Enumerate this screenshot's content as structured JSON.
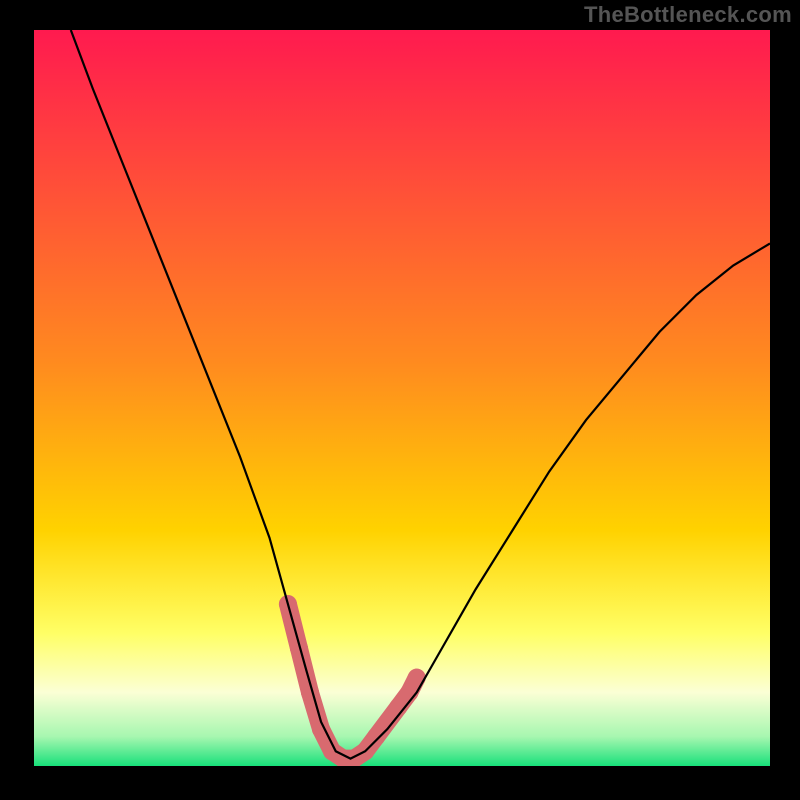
{
  "attribution": "TheBottleneck.com",
  "colors": {
    "bg_top": "#ff1a4f",
    "bg_mid": "#ffd200",
    "bg_low_yellow": "#ffff66",
    "bg_low_cream": "#fbffd5",
    "bg_bottom_green": "#18e07a",
    "page_bg": "#000000",
    "curve": "#000000",
    "marker": "#d86a6f"
  },
  "chart_data": {
    "type": "line",
    "title": "",
    "xlabel": "",
    "ylabel": "",
    "xlim": [
      0,
      100
    ],
    "ylim": [
      0,
      100
    ],
    "grid": false,
    "legend": false,
    "series": [
      {
        "name": "bottleneck_curve",
        "x": [
          5,
          8,
          12,
          16,
          20,
          24,
          28,
          32,
          34.5,
          37,
          39,
          41,
          43,
          45,
          48,
          52,
          56,
          60,
          65,
          70,
          75,
          80,
          85,
          90,
          95,
          100
        ],
        "y": [
          100,
          92,
          82,
          72,
          62,
          52,
          42,
          31,
          22,
          13,
          6,
          2,
          1,
          2,
          5,
          10,
          17,
          24,
          32,
          40,
          47,
          53,
          59,
          64,
          68,
          71
        ]
      }
    ],
    "markers": {
      "name": "highlight_points",
      "comment": "salmon rounded segments near curve minimum",
      "points": [
        {
          "x": 34.5,
          "y": 22
        },
        {
          "x": 36.0,
          "y": 16
        },
        {
          "x": 37.5,
          "y": 10
        },
        {
          "x": 39.0,
          "y": 5
        },
        {
          "x": 40.5,
          "y": 2
        },
        {
          "x": 42.0,
          "y": 1
        },
        {
          "x": 43.5,
          "y": 1
        },
        {
          "x": 45.0,
          "y": 2
        },
        {
          "x": 46.5,
          "y": 4
        },
        {
          "x": 49.5,
          "y": 8
        },
        {
          "x": 51.0,
          "y": 10
        },
        {
          "x": 52.0,
          "y": 12
        }
      ]
    }
  }
}
